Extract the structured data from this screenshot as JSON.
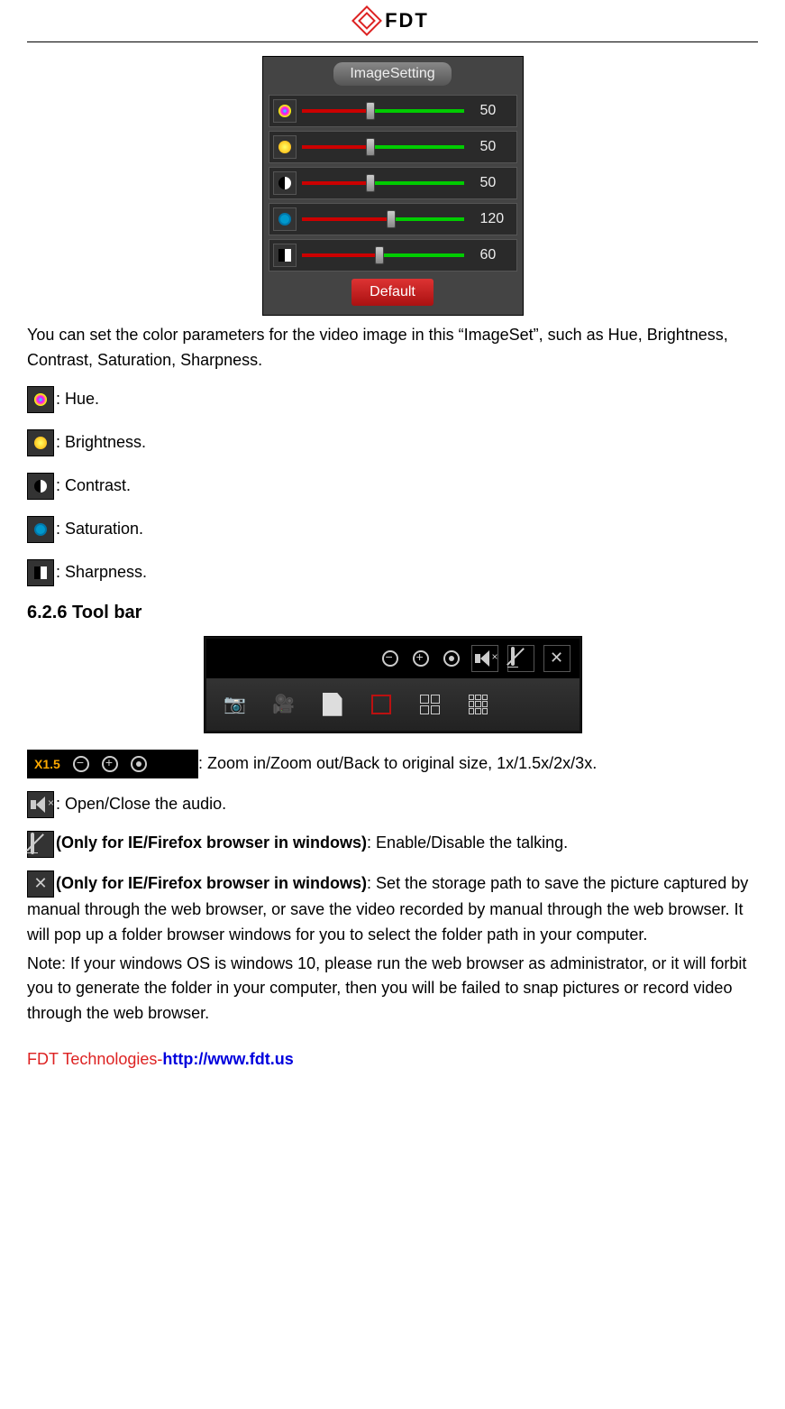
{
  "header": {
    "brand": "FDT"
  },
  "imageset": {
    "title": "ImageSetting",
    "sliders": [
      {
        "key": "hue",
        "value": "50",
        "ratio": 0.42
      },
      {
        "key": "brightness",
        "value": "50",
        "ratio": 0.42
      },
      {
        "key": "contrast",
        "value": "50",
        "ratio": 0.42
      },
      {
        "key": "saturation",
        "value": "120",
        "ratio": 0.55
      },
      {
        "key": "sharpness",
        "value": "60",
        "ratio": 0.48
      }
    ],
    "default_label": "Default"
  },
  "intro": "You can set the color parameters for the video image in this “ImageSet”, such as Hue, Brightness, Contrast, Saturation, Sharpness.",
  "legend": {
    "hue": ": Hue.",
    "brightness": ": Brightness.",
    "contrast": ": Contrast.",
    "saturation": ": Saturation.",
    "sharpness": ": Sharpness."
  },
  "section_title": "6.2.6 Tool bar",
  "toolbar": {
    "zoom_label": "X1.5",
    "zoom_desc": ": Zoom in/Zoom out/Back to original size, 1x/1.5x/2x/3x.",
    "audio_desc": ": Open/Close the audio.",
    "talk_prefix": "(Only for IE/Firefox browser in windows)",
    "talk_desc": ": Enable/Disable the talking.",
    "path_prefix": "(Only for IE/Firefox browser in windows)",
    "path_desc": ": Set the storage path to save the picture captured by manual through the web browser, or save the video recorded by manual through the web browser. It will pop up a folder browser windows for you to select the folder path in your computer.",
    "note": "Note: If your windows OS is windows 10, please run the web browser as administrator, or it will forbit you to generate the folder in your computer, then you will be failed to snap pictures or record video through the web browser."
  },
  "footer": {
    "company": "FDT Technologies-",
    "url": "http://www.fdt.us"
  }
}
